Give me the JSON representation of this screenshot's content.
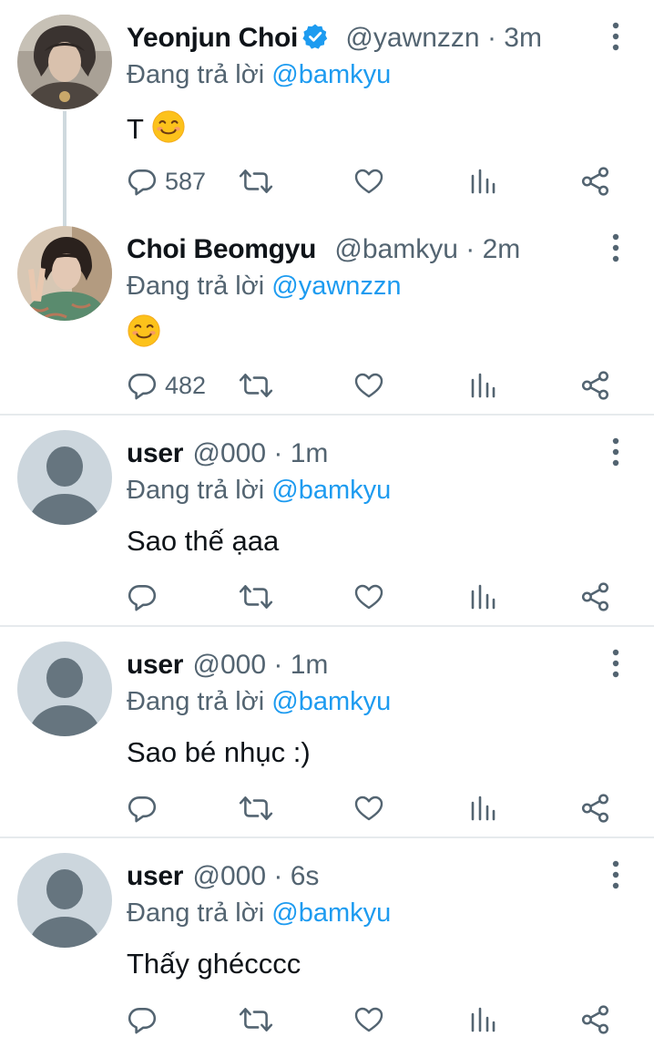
{
  "reply_prefix": "Đang trả lời",
  "tweets": [
    {
      "name": "Yeonjun Choi",
      "verified": true,
      "handle": "@yawnzzn",
      "separator": "·",
      "time": "3m",
      "reply_to": "@bamkyu",
      "body_text": "T",
      "has_emoji": true,
      "reply_count": "587"
    },
    {
      "name": "Choi Beomgyu",
      "verified": false,
      "handle": "@bamkyu",
      "separator": "·",
      "time": "2m",
      "reply_to": "@yawnzzn",
      "body_text": "",
      "has_emoji": true,
      "reply_count": "482"
    },
    {
      "name": "user",
      "handle": "@000",
      "separator": "·",
      "time": "1m",
      "reply_to": "@bamkyu",
      "body_text": "Sao thế ạaa",
      "reply_count": ""
    },
    {
      "name": "user",
      "handle": "@000",
      "separator": "·",
      "time": "1m",
      "reply_to": "@bamkyu",
      "body_text": "Sao bé nhục :)",
      "reply_count": ""
    },
    {
      "name": "user",
      "handle": "@000",
      "separator": "·",
      "time": "6s",
      "reply_to": "@bamkyu",
      "body_text": "Thấy ghécccc",
      "reply_count": ""
    }
  ],
  "colors": {
    "accent": "#1d9bf0",
    "secondary_text": "#536471",
    "primary_text": "#0f1419",
    "divider": "#e6eaed"
  },
  "icons": [
    "verified-badge-icon",
    "more-options-icon",
    "reply-icon",
    "retweet-icon",
    "like-icon",
    "views-icon",
    "share-icon",
    "smiling-face-emoji"
  ]
}
